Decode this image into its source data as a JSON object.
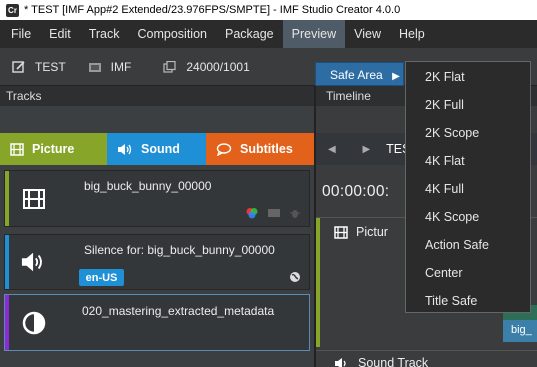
{
  "window": {
    "title": "* TEST [IMF App#2 Extended/23.976FPS/SMPTE] - IMF Studio Creator 4.0.0",
    "app_icon_text": "Cr"
  },
  "menubar": {
    "items": [
      "File",
      "Edit",
      "Track",
      "Composition",
      "Package",
      "Preview",
      "View",
      "Help"
    ],
    "active": "Preview"
  },
  "toolbar": {
    "items": [
      {
        "icon": "edit-icon",
        "label": "TEST"
      },
      {
        "icon": "film-folder-icon",
        "label": "IMF"
      },
      {
        "icon": "copy-icon",
        "label": "24000/1001"
      }
    ]
  },
  "panels": {
    "tracks_title": "Tracks",
    "timeline_title": "Timeline"
  },
  "track_tabs": [
    {
      "label": "Picture",
      "icon": "film-icon",
      "color": "#86a529"
    },
    {
      "label": "Sound",
      "icon": "speaker-icon",
      "color": "#1f8fd6"
    },
    {
      "label": "Subtitles",
      "icon": "speech-bubble-icon",
      "color": "#e2621b"
    }
  ],
  "tracks": [
    {
      "name": "big_buck_bunny_00000",
      "type": "picture",
      "color": "#86a529"
    },
    {
      "name": "Silence for: big_buck_bunny_00000",
      "type": "sound",
      "color": "#1f8fd6",
      "language": "en-US"
    },
    {
      "name": "020_mastering_extracted_metadata",
      "type": "metadata",
      "color": "#8b2bd6"
    }
  ],
  "timeline": {
    "composition_name": "TES",
    "timecode": "00:00:00:",
    "picture_track_label": "Pictur",
    "clip_label": "big_",
    "sound_track_label": "Sound Track"
  },
  "preview_menu": {
    "submenu_label": "Safe Area",
    "items": [
      "2K Flat",
      "2K Full",
      "2K Scope",
      "4K Flat",
      "4K Full",
      "4K Scope",
      "Action Safe",
      "Center",
      "Title Safe"
    ]
  }
}
